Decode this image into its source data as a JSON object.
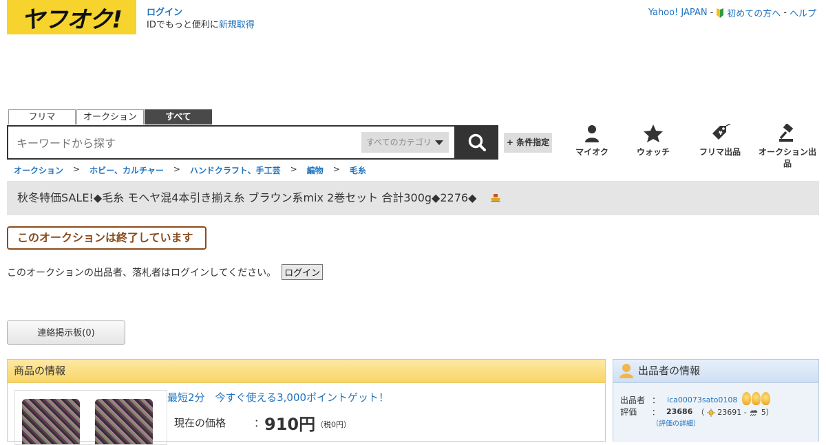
{
  "header": {
    "logo_text": "ヤフオク!",
    "login_link": "ログイン",
    "login_sub_prefix": "IDでもっと便利に",
    "signup_link": "新規取得",
    "top_links": [
      "Yahoo! JAPAN",
      "初めての方へ",
      "ヘルプ"
    ],
    "top_sep": "-"
  },
  "search": {
    "tabs": [
      {
        "label": "フリマ",
        "active": false
      },
      {
        "label": "オークション",
        "active": false
      },
      {
        "label": "すべて",
        "active": true
      }
    ],
    "placeholder": "キーワードから探す",
    "category_select": "すべてのカテゴリ",
    "condition_button": "+ 条件指定"
  },
  "nav": [
    {
      "label": "マイオク",
      "icon": "person-icon"
    },
    {
      "label": "ウォッチ",
      "icon": "star-icon"
    },
    {
      "label": "フリマ出品",
      "icon": "price-tag-icon"
    },
    {
      "label": "オークション出品",
      "icon": "gavel-icon"
    }
  ],
  "breadcrumb": {
    "items": [
      "オークション",
      "ホビー、カルチャー",
      "ハンドクラフト、手工芸",
      "編物",
      "毛糸"
    ],
    "separator": ">"
  },
  "item": {
    "title": "秋冬特価SALE!◆毛糸 モヘヤ混4本引き揃え糸 ブラウン系mix 2巻セット 合計300g◆2276◆",
    "ended_text": "このオークションは終了しています",
    "login_notice": "このオークションの出品者、落札者はログインしてください。",
    "login_button": "ログイン",
    "board_button": "連絡掲示板(0)"
  },
  "item_info": {
    "heading": "商品の情報",
    "promo": "最短2分　今すぐ使える3,000ポイントゲット！",
    "price_label": "現在の価格",
    "price_colon": "：",
    "price_value": "910円",
    "price_tax": "（税0円）"
  },
  "seller": {
    "heading": "出品者の情報",
    "seller_label": "出品者",
    "seller_name": "ica00073sato0108",
    "rating_label": "評価",
    "rating_total": "23686",
    "rating_good": "23691",
    "rating_bad": "5",
    "rating_open": "（",
    "rating_dash": "-",
    "rating_close": "）",
    "colon": "：",
    "rating_detail": "（評価の詳細）"
  },
  "colors": {
    "logo_bg": "#f6d32d",
    "link": "#1e73be",
    "ended_border": "#8b4a1a",
    "tab_active": "#494949"
  }
}
